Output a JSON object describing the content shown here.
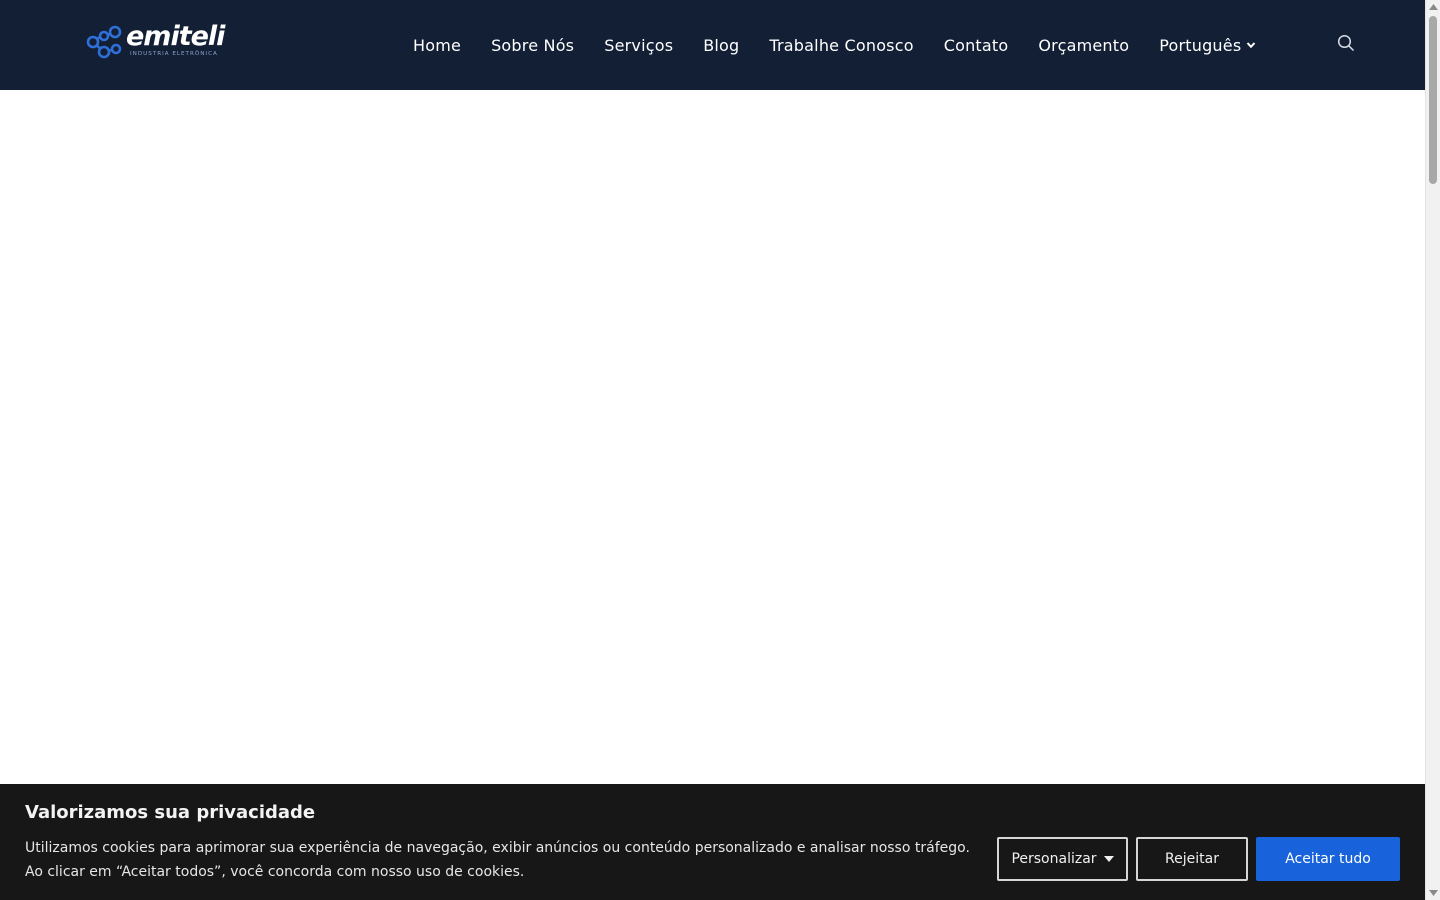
{
  "brand": {
    "name": "emiteli",
    "tagline": "INDUSTRIA ELETRÔNICA",
    "colors": {
      "header_bg": "#131f35",
      "logo_blue": "#2f6fd8",
      "accept_blue": "#1863dc",
      "banner_bg": "#171717"
    }
  },
  "nav": {
    "items": [
      {
        "label": "Home"
      },
      {
        "label": "Sobre Nós"
      },
      {
        "label": "Serviços"
      },
      {
        "label": "Blog"
      },
      {
        "label": "Trabalhe Conosco"
      },
      {
        "label": "Contato"
      },
      {
        "label": "Orçamento"
      }
    ],
    "language": {
      "label": "Português",
      "icon": "chevron-down-icon"
    },
    "search_icon": "search-icon"
  },
  "cookie_banner": {
    "title": "Valorizamos sua privacidade",
    "text_line1": "Utilizamos cookies para aprimorar sua experiência de navegação, exibir anúncios ou conteúdo personalizado e analisar nosso tráfego.",
    "text_line2": "Ao clicar em “Aceitar todos”, você concorda com nosso uso de cookies.",
    "customize_label": "Personalizar",
    "reject_label": "Rejeitar",
    "accept_label": "Aceitar tudo"
  }
}
